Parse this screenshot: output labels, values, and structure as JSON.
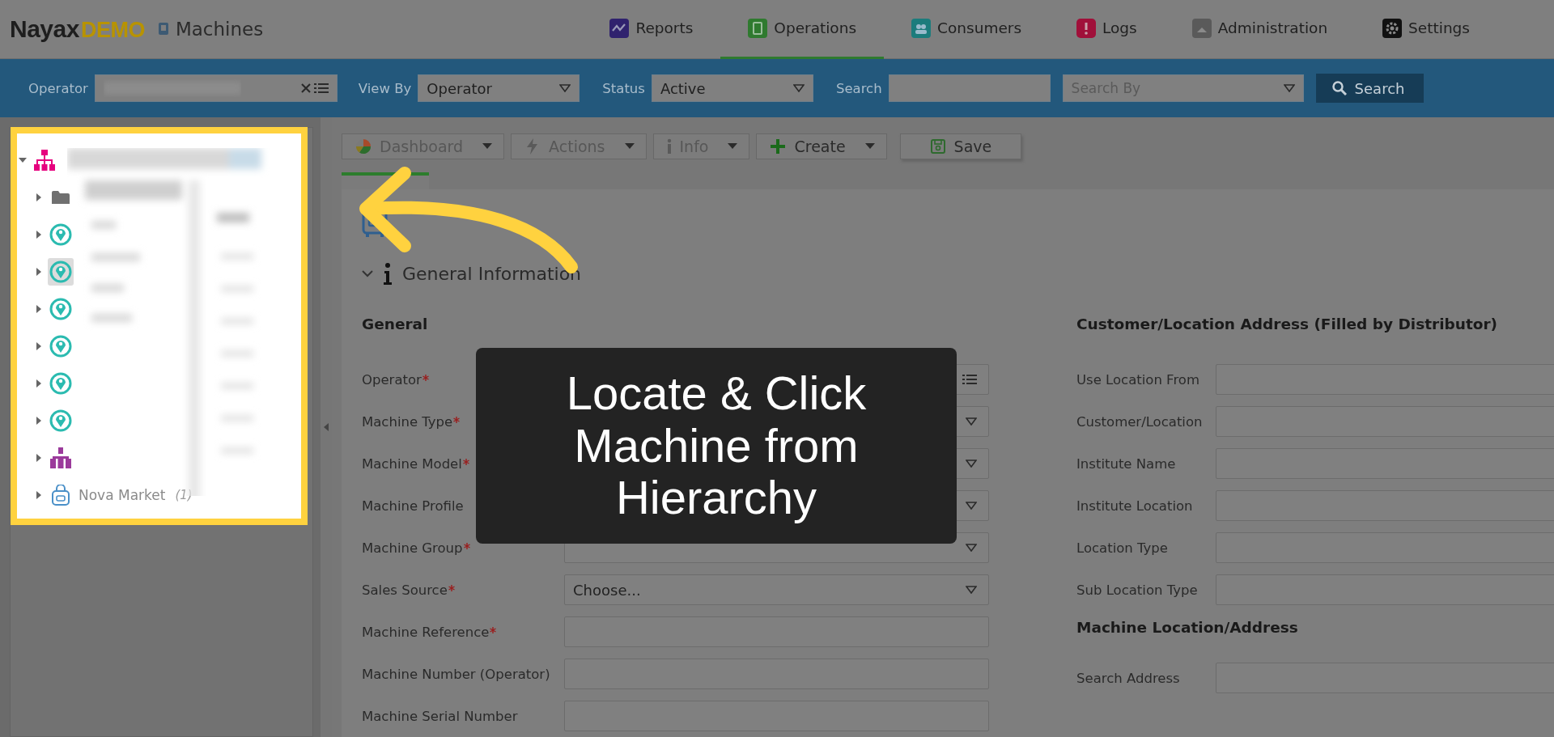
{
  "header": {
    "logo": {
      "brand": "Nayax",
      "suffix": "DEMO"
    },
    "page_title": "Machines",
    "nav": [
      {
        "label": "Reports",
        "selected": false
      },
      {
        "label": "Operations",
        "selected": true
      },
      {
        "label": "Consumers",
        "selected": false
      },
      {
        "label": "Logs",
        "selected": false
      },
      {
        "label": "Administration",
        "selected": false
      },
      {
        "label": "Settings",
        "selected": false
      }
    ]
  },
  "filter_bar": {
    "operator": {
      "label": "Operator"
    },
    "view_by": {
      "label": "View By",
      "value": "Operator"
    },
    "status": {
      "label": "Status",
      "value": "Active"
    },
    "search": {
      "label": "Search"
    },
    "search_by": {
      "placeholder": "Search By"
    },
    "search_button": "Search"
  },
  "tree": {
    "root": {
      "kind": "hierarchy",
      "expanded": true,
      "selected": false,
      "children": [
        {
          "kind": "folder",
          "expanded": false,
          "selected": false
        },
        {
          "kind": "location",
          "expanded": false,
          "selected": false
        },
        {
          "kind": "location",
          "expanded": false,
          "selected": true
        },
        {
          "kind": "location",
          "expanded": false,
          "selected": false
        },
        {
          "kind": "location",
          "expanded": false,
          "selected": false
        },
        {
          "kind": "location",
          "expanded": false,
          "selected": false
        },
        {
          "kind": "location",
          "expanded": false,
          "selected": false
        },
        {
          "kind": "group",
          "expanded": false,
          "selected": false
        },
        {
          "kind": "store",
          "expanded": false,
          "selected": false,
          "label": "Nova Market",
          "count": "(1)"
        }
      ]
    }
  },
  "toolbar": [
    {
      "label": "Dashboard",
      "disabled": true,
      "dropdown": true
    },
    {
      "label": "Actions",
      "disabled": true,
      "dropdown": true
    },
    {
      "label": "Info",
      "disabled": true,
      "dropdown": true
    },
    {
      "label": "Create",
      "disabled": false,
      "dropdown": true
    },
    {
      "label": "Save",
      "disabled": false,
      "dropdown": false
    }
  ],
  "section": {
    "title": "General Information",
    "expanded": true
  },
  "general": {
    "heading": "General",
    "fields": [
      {
        "label": "Operator",
        "required": true,
        "kind": "list"
      },
      {
        "label": "Machine Type",
        "required": true,
        "kind": "select"
      },
      {
        "label": "Machine Model",
        "required": true,
        "kind": "select"
      },
      {
        "label": "Machine Profile",
        "required": false,
        "kind": "select"
      },
      {
        "label": "Machine Group",
        "required": true,
        "kind": "select"
      },
      {
        "label": "Sales Source",
        "required": true,
        "kind": "select",
        "value": "Choose..."
      },
      {
        "label": "Machine Reference",
        "required": true,
        "kind": "input"
      },
      {
        "label": "Machine Number (Operator)",
        "required": false,
        "kind": "input"
      },
      {
        "label": "Machine Serial Number",
        "required": false,
        "kind": "input"
      }
    ]
  },
  "customer_address": {
    "heading": "Customer/Location Address (Filled by Distributor)",
    "fields": [
      {
        "label": "Use Location From",
        "required": false
      },
      {
        "label": "Customer/Location",
        "required": false
      },
      {
        "label": "Institute Name",
        "required": false
      },
      {
        "label": "Institute Location",
        "required": false
      },
      {
        "label": "Location Type",
        "required": false
      },
      {
        "label": "Sub Location Type",
        "required": false
      }
    ]
  },
  "machine_address": {
    "heading": "Machine Location/Address",
    "fields": [
      {
        "label": "Search Address",
        "required": false
      }
    ]
  },
  "caption": "Locate & Click Machine from Hierarchy"
}
